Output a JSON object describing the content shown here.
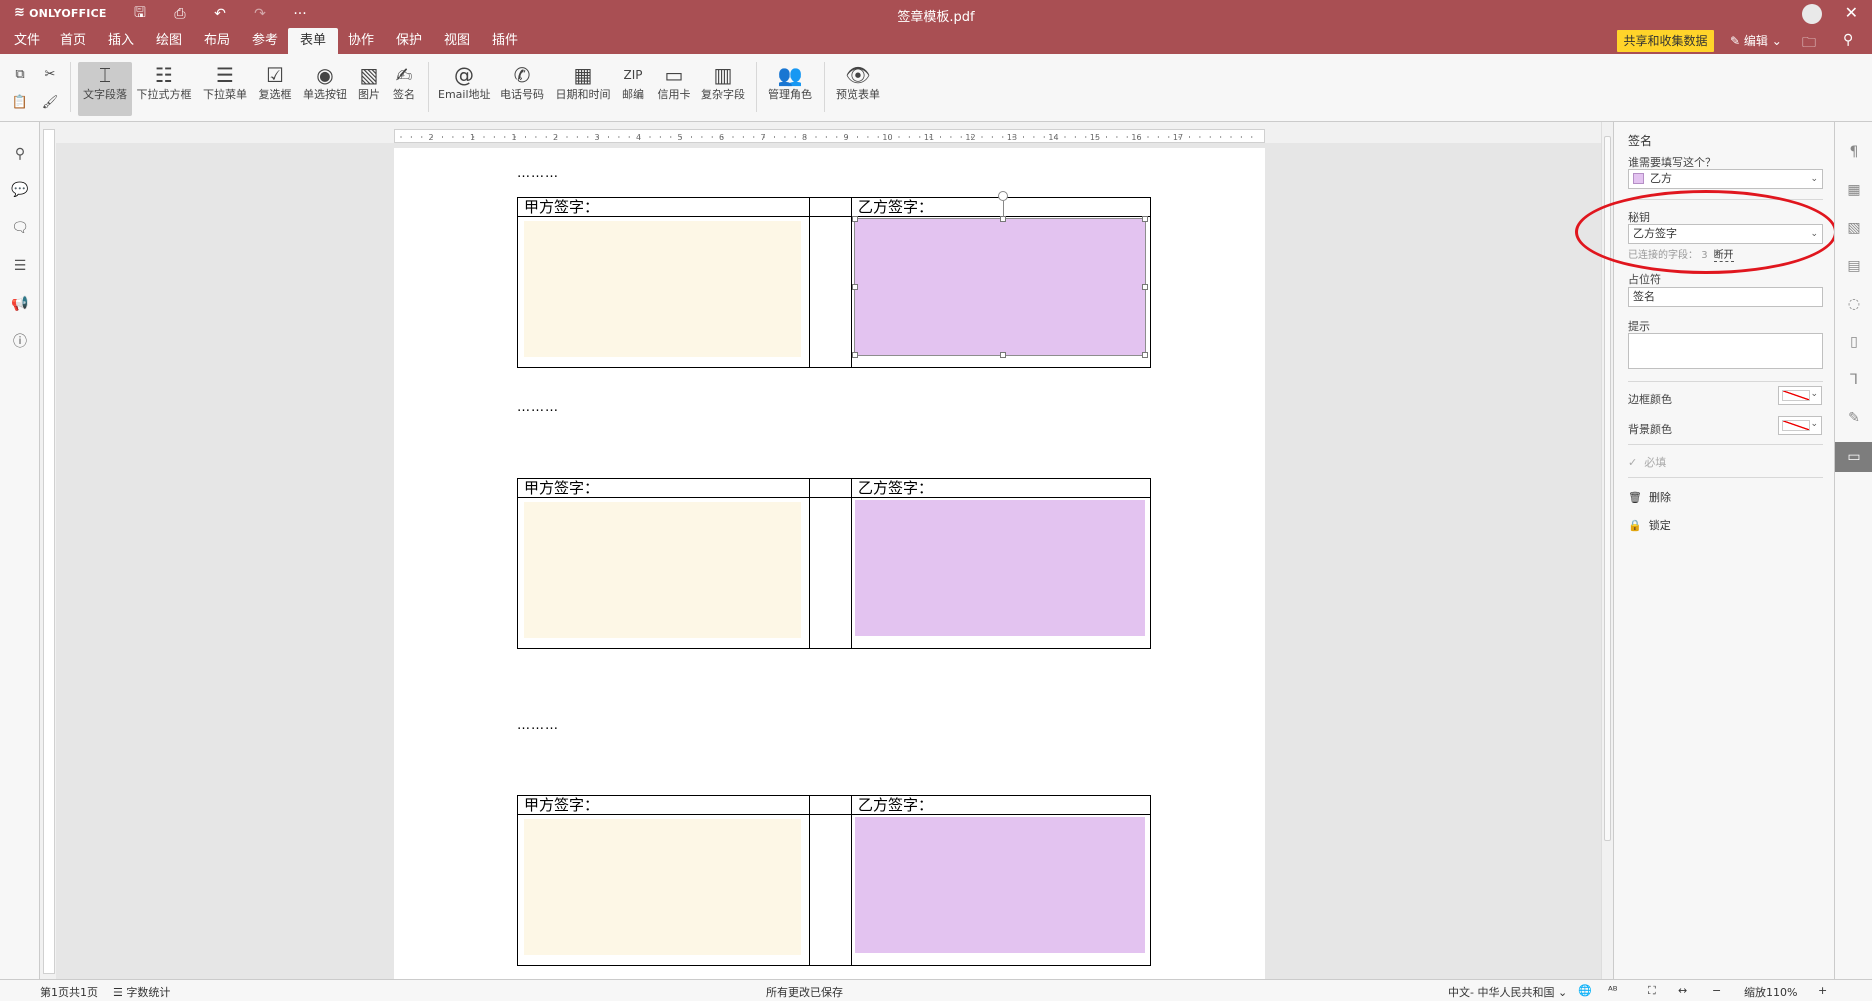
{
  "app": {
    "logo": "ONLYOFFICE",
    "doc_title": "签章模板.pdf"
  },
  "menu": {
    "tabs": [
      "文件",
      "首页",
      "插入",
      "绘图",
      "布局",
      "参考",
      "表单",
      "协作",
      "保护",
      "视图",
      "插件"
    ],
    "active_tab": "表单",
    "share_label": "共享和收集数据",
    "edit_label": "编辑"
  },
  "toolbar": {
    "buttons": [
      {
        "label": "文字段落",
        "icon": "text-field-icon"
      },
      {
        "label": "下拉式方框",
        "icon": "combo-box-icon"
      },
      {
        "label": "下拉菜单",
        "icon": "dropdown-icon"
      },
      {
        "label": "复选框",
        "icon": "checkbox-icon"
      },
      {
        "label": "单选按钮",
        "icon": "radio-icon"
      },
      {
        "label": "图片",
        "icon": "image-icon"
      },
      {
        "label": "签名",
        "icon": "signature-icon"
      },
      {
        "label": "Email地址",
        "icon": "at-icon"
      },
      {
        "label": "电话号码",
        "icon": "phone-icon"
      },
      {
        "label": "日期和时间",
        "icon": "calendar-icon"
      },
      {
        "label": "邮编",
        "icon": "zip-icon"
      },
      {
        "label": "信用卡",
        "icon": "credit-card-icon"
      },
      {
        "label": "复杂字段",
        "icon": "complex-field-icon"
      },
      {
        "label": "管理角色",
        "icon": "roles-icon"
      },
      {
        "label": "预览表单",
        "icon": "eye-icon"
      }
    ]
  },
  "document": {
    "dots": "………",
    "blocks": [
      {
        "party_a": "甲方签字：",
        "party_b": "乙方签字："
      },
      {
        "party_a": "甲方签字：",
        "party_b": "乙方签字："
      },
      {
        "party_a": "甲方签字：",
        "party_b": "乙方签字："
      }
    ],
    "ruler_numbers": [
      "2",
      "1",
      "1",
      "2",
      "3",
      "4",
      "5",
      "6",
      "7",
      "8",
      "9",
      "10",
      "11",
      "12",
      "13",
      "14",
      "15",
      "16",
      "17"
    ]
  },
  "panel": {
    "title": "签名",
    "who_label": "谁需要填写这个？",
    "who_value": "乙方",
    "key_label": "秘钥",
    "key_value": "乙方签字",
    "connected_label": "已连接的字段：",
    "connected_count": "3",
    "disconnect_label": "断开",
    "placeholder_label": "占位符",
    "placeholder_value": "签名",
    "hint_label": "提示",
    "hint_value": "",
    "border_color_label": "边框颜色",
    "bg_color_label": "背景颜色",
    "required_label": "必填",
    "delete_label": "删除",
    "lock_label": "锁定",
    "role_color": "#e3c3f0"
  },
  "status": {
    "page": "第1页共1页",
    "word_count": "字数统计",
    "saved": "所有更改已保存",
    "language": "中文- 中华人民共和国",
    "zoom": "缩放110%"
  },
  "colors": {
    "brand": "#a94f53",
    "accent_button": "#ffd42a",
    "field_a": "#fdf7e6",
    "field_b": "#e3c3f0",
    "highlight": "#e0161e"
  }
}
